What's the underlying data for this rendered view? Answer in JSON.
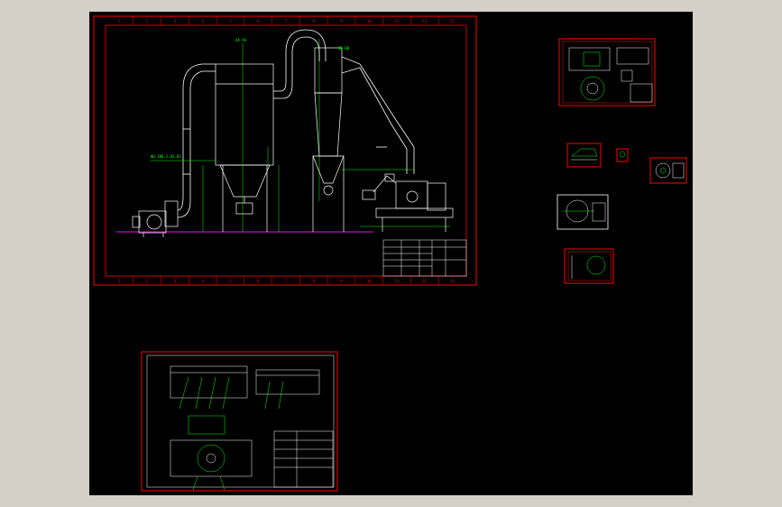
{
  "viewport": {
    "background": "#000000",
    "frame_color": "#ff0000",
    "line_color": "#ffffff",
    "dim_color": "#00ff00",
    "accent_color": "#00ffff",
    "ground_color": "#ff00ff"
  },
  "main_sheet": {
    "column_numbers": [
      "1",
      "2",
      "3",
      "4",
      "5",
      "6",
      "7",
      "8",
      "9",
      "10",
      "11",
      "12",
      "13"
    ],
    "labels": {
      "pipe_label": "ΦD-100.5.03.03",
      "section_a": "AA-AA",
      "section_b": "BB-BB"
    }
  },
  "detail_sheets": [
    {
      "name": "detail-sheet-1"
    },
    {
      "name": "detail-sheet-2"
    },
    {
      "name": "detail-sheet-3"
    },
    {
      "name": "detail-sheet-4"
    },
    {
      "name": "detail-sheet-5"
    },
    {
      "name": "detail-sheet-6"
    }
  ],
  "assembly_sheet": {
    "name": "assembly-sheet"
  }
}
